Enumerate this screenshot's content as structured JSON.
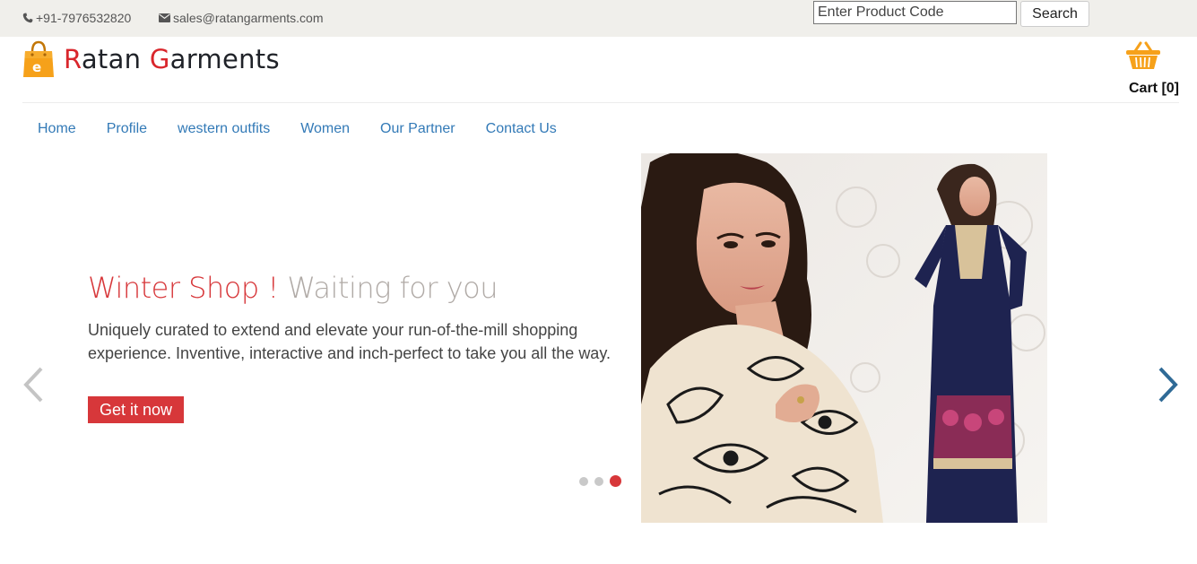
{
  "topbar": {
    "phone": "+91-7976532820",
    "email": "sales@ratangarments.com",
    "search_placeholder": "Enter Product Code",
    "search_button": "Search"
  },
  "brand": {
    "initial_1": "R",
    "rest_1": "atan ",
    "initial_2": "G",
    "rest_2": "arments"
  },
  "cart": {
    "label": "Cart [0]"
  },
  "nav": {
    "items": [
      {
        "label": "Home"
      },
      {
        "label": "Profile"
      },
      {
        "label": "western outfits"
      },
      {
        "label": "Women"
      },
      {
        "label": "Our Partner"
      },
      {
        "label": "Contact Us"
      }
    ]
  },
  "hero": {
    "title_highlight": "Winter Shop !",
    "title_rest": " Waiting for you",
    "description": "Uniquely curated to extend and elevate your run-of-the-mill shopping experience. Inventive, interactive and inch-perfect to take you all the way.",
    "cta_label": "Get it now",
    "slide_count": 3,
    "active_slide": 3
  },
  "colors": {
    "accent": "#d7373a",
    "link": "#337ab7",
    "topbar_bg": "#f0efeb",
    "cart_orange": "#f6a11a"
  },
  "icons": {
    "phone": "phone-icon",
    "email": "envelope-icon",
    "logo": "shopping-bag-icon",
    "cart": "basket-icon",
    "prev": "chevron-left-icon",
    "next": "chevron-right-icon"
  }
}
